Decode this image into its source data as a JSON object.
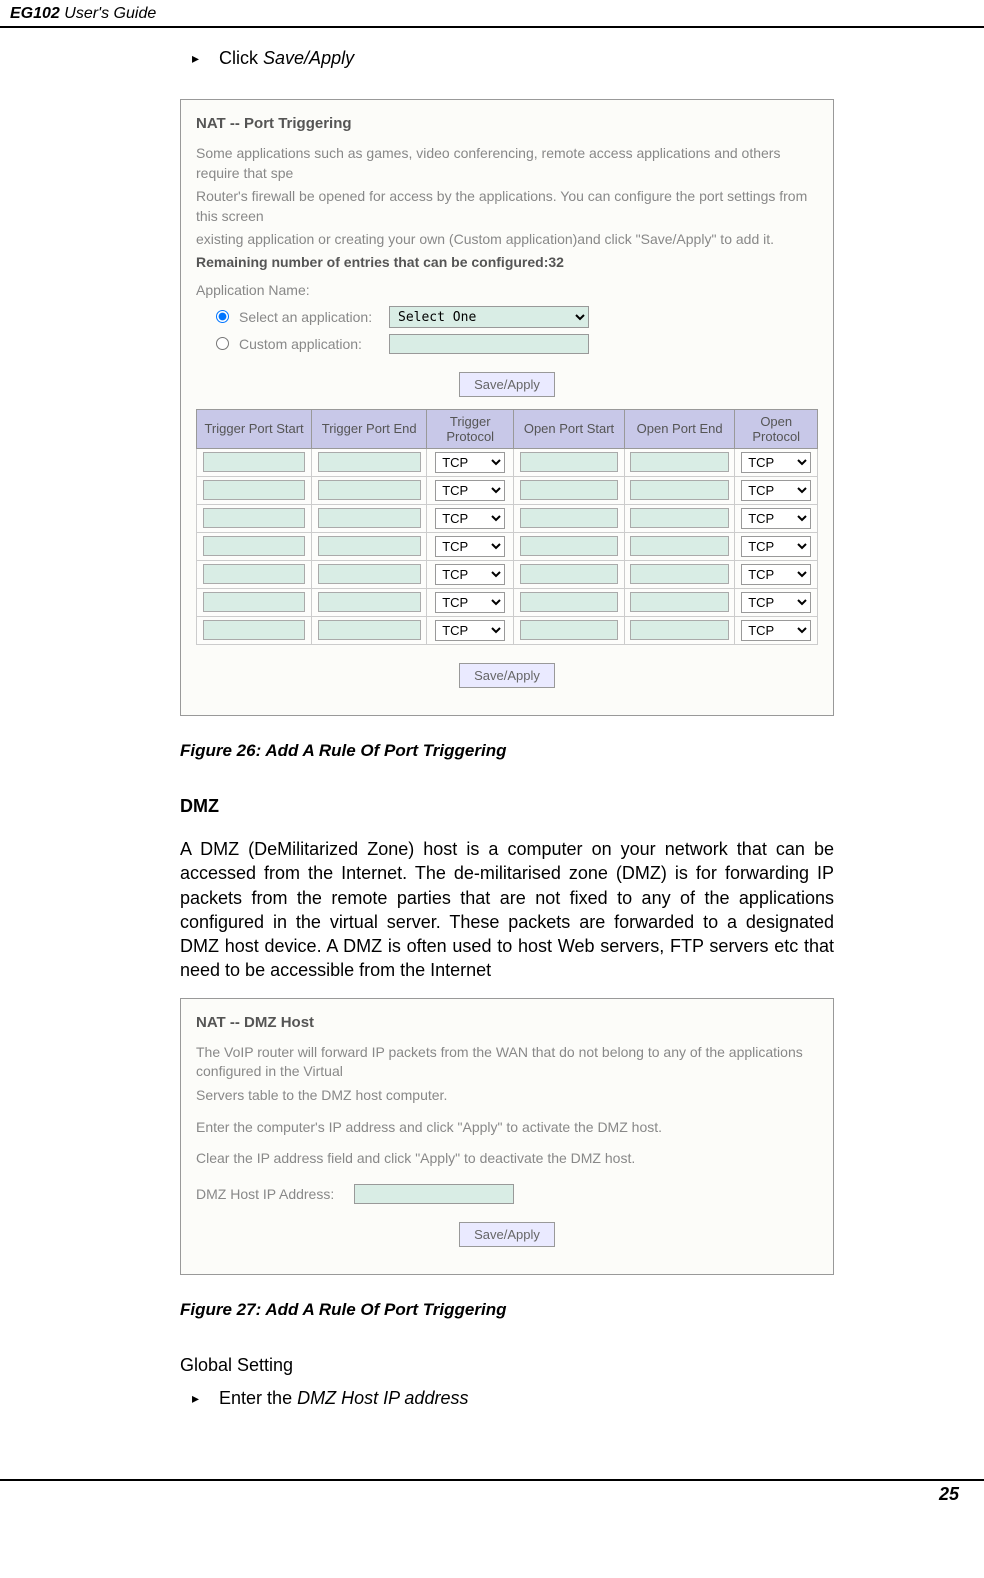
{
  "header": {
    "product": "EG102",
    "suffix": " User's Guide"
  },
  "top_bullet": {
    "prefix": "Click ",
    "action": "Save/Apply"
  },
  "screenshot1": {
    "title": "NAT -- Port Triggering",
    "desc1": "Some applications such as games, video conferencing, remote access applications and others require that spe",
    "desc2": "Router's firewall be opened for access by the applications. You can configure the port settings from this screen",
    "desc3": "existing application or creating your own (Custom application)and click \"Save/Apply\" to add it.",
    "remaining": "Remaining number of entries that can be configured:32",
    "app_name_label": "Application Name:",
    "select_label": "Select an application:",
    "custom_label": "Custom application:",
    "select_placeholder": "Select One",
    "save_apply": "Save/Apply",
    "table": {
      "headers": [
        "Trigger Port Start",
        "Trigger Port End",
        "Trigger Protocol",
        "Open Port Start",
        "Open Port End",
        "Open Protocol"
      ],
      "protocol_option": "TCP",
      "rows": 7
    }
  },
  "figure26": "Figure 26: Add A Rule Of Port Triggering",
  "dmz_heading": "DMZ",
  "dmz_body": "A DMZ (DeMilitarized Zone) host is a computer on your network that can be accessed from the Internet. The de-militarised zone (DMZ) is for forwarding IP packets from the remote parties that are not fixed to any of the applications configured in the virtual server. These packets are forwarded to a designated DMZ host device. A DMZ is often used to host Web servers, FTP servers etc that need to be accessible from the Internet",
  "screenshot2": {
    "title": "NAT -- DMZ Host",
    "desc1": "The VoIP router will forward IP packets from the WAN that do not belong to any of the applications configured in the Virtual",
    "desc2": "Servers table to the DMZ host computer.",
    "desc3": "Enter the computer's IP address and click \"Apply\" to activate the DMZ host.",
    "desc4": "Clear the IP address field and click \"Apply\" to deactivate the DMZ host.",
    "ip_label": "DMZ Host IP Address:",
    "save_apply": "Save/Apply"
  },
  "figure27": "Figure 27: Add A Rule Of Port Triggering",
  "global_setting": "Global Setting",
  "bottom_bullet": {
    "prefix": "Enter the ",
    "action": "DMZ Host IP address"
  },
  "page_number": "25"
}
